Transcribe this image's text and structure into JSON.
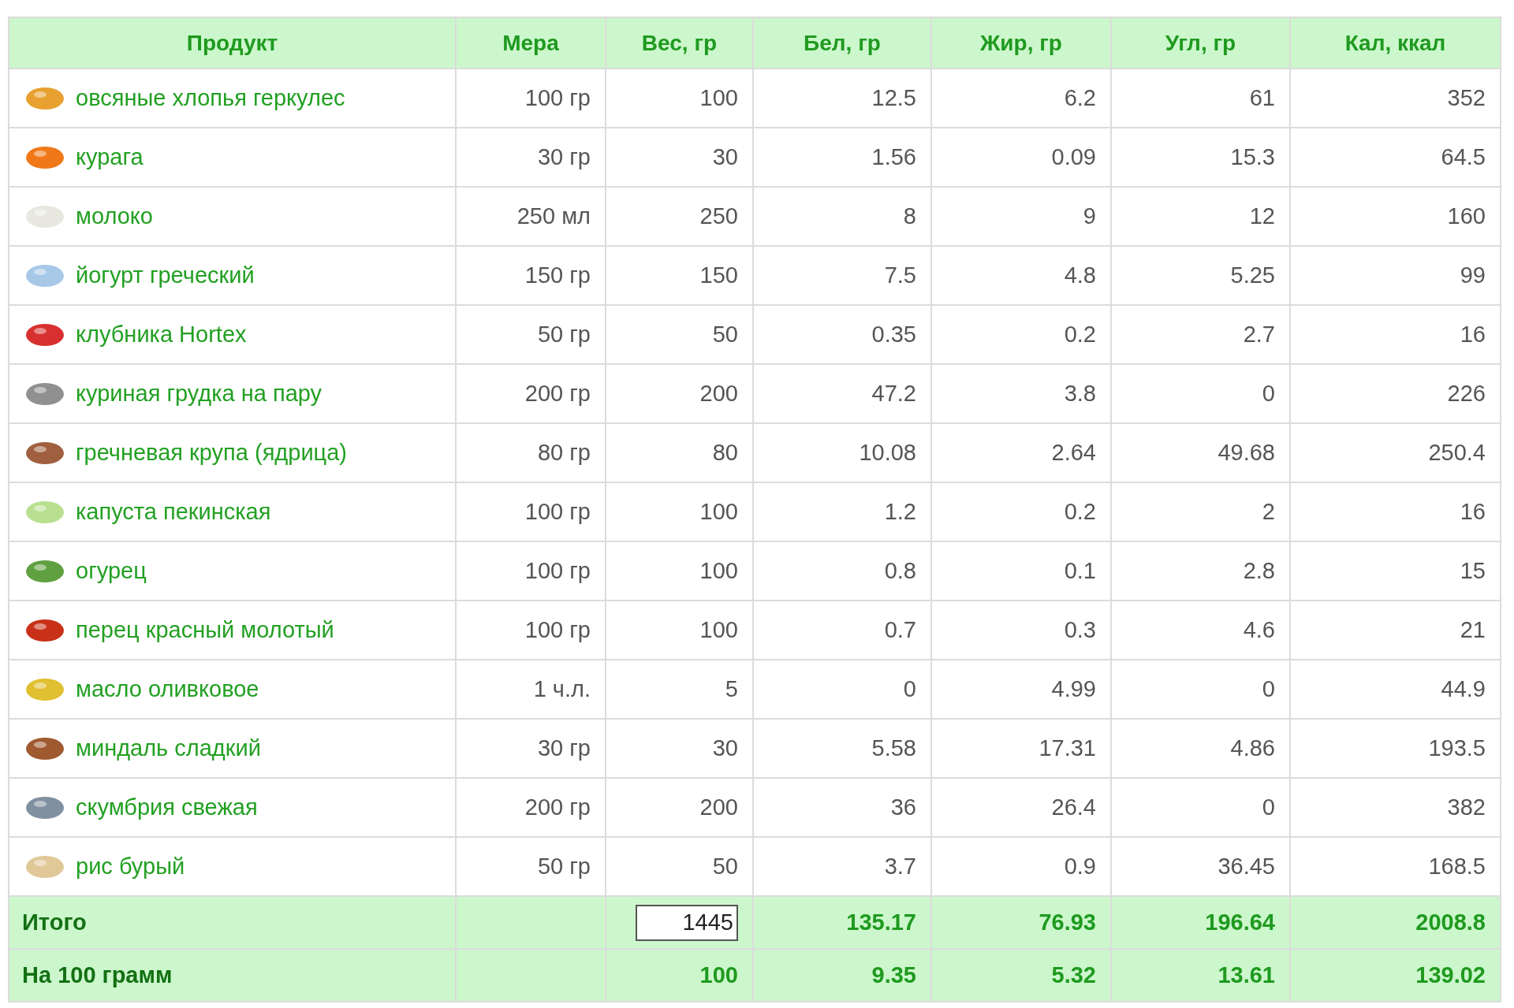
{
  "table": {
    "columns": [
      "Продукт",
      "Мера",
      "Вес, гр",
      "Бел, гр",
      "Жир, гр",
      "Угл, гр",
      "Кал, ккал"
    ],
    "rows": [
      {
        "product": "овсяные хлопья геркулес",
        "measure": "100 гр",
        "weight": "100",
        "protein": "12.5",
        "fat": "6.2",
        "carbs": "61",
        "kcal": "352"
      },
      {
        "product": "курага",
        "measure": "30 гр",
        "weight": "30",
        "protein": "1.56",
        "fat": "0.09",
        "carbs": "15.3",
        "kcal": "64.5"
      },
      {
        "product": "молоко",
        "measure": "250 мл",
        "weight": "250",
        "protein": "8",
        "fat": "9",
        "carbs": "12",
        "kcal": "160"
      },
      {
        "product": "йогурт греческий",
        "measure": "150 гр",
        "weight": "150",
        "protein": "7.5",
        "fat": "4.8",
        "carbs": "5.25",
        "kcal": "99"
      },
      {
        "product": "клубника Hortex",
        "measure": "50 гр",
        "weight": "50",
        "protein": "0.35",
        "fat": "0.2",
        "carbs": "2.7",
        "kcal": "16"
      },
      {
        "product": "куриная грудка на пару",
        "measure": "200 гр",
        "weight": "200",
        "protein": "47.2",
        "fat": "3.8",
        "carbs": "0",
        "kcal": "226"
      },
      {
        "product": "гречневая крупа (ядрица)",
        "measure": "80 гр",
        "weight": "80",
        "protein": "10.08",
        "fat": "2.64",
        "carbs": "49.68",
        "kcal": "250.4"
      },
      {
        "product": "капуста пекинская",
        "measure": "100 гр",
        "weight": "100",
        "protein": "1.2",
        "fat": "0.2",
        "carbs": "2",
        "kcal": "16"
      },
      {
        "product": "огурец",
        "measure": "100 гр",
        "weight": "100",
        "protein": "0.8",
        "fat": "0.1",
        "carbs": "2.8",
        "kcal": "15"
      },
      {
        "product": "перец красный молотый",
        "measure": "100 гр",
        "weight": "100",
        "protein": "0.7",
        "fat": "0.3",
        "carbs": "4.6",
        "kcal": "21"
      },
      {
        "product": "масло оливковое",
        "measure": "1 ч.л.",
        "weight": "5",
        "protein": "0",
        "fat": "4.99",
        "carbs": "0",
        "kcal": "44.9"
      },
      {
        "product": "миндаль сладкий",
        "measure": "30 гр",
        "weight": "30",
        "protein": "5.58",
        "fat": "17.31",
        "carbs": "4.86",
        "kcal": "193.5"
      },
      {
        "product": "скумбрия свежая",
        "measure": "200 гр",
        "weight": "200",
        "protein": "36",
        "fat": "26.4",
        "carbs": "0",
        "kcal": "382"
      },
      {
        "product": "рис бурый",
        "measure": "50 гр",
        "weight": "50",
        "protein": "3.7",
        "fat": "0.9",
        "carbs": "36.45",
        "kcal": "168.5"
      }
    ],
    "totals": [
      {
        "label": "Итого",
        "kind": "field",
        "weight": "1445",
        "protein": "135.17",
        "fat": "76.93",
        "carbs": "196.64",
        "kcal": "2008.8"
      },
      {
        "label": "На 100 грамм",
        "kind": "text",
        "weight": "100",
        "protein": "9.35",
        "fat": "5.32",
        "carbs": "13.61",
        "kcal": "139.02"
      }
    ]
  }
}
